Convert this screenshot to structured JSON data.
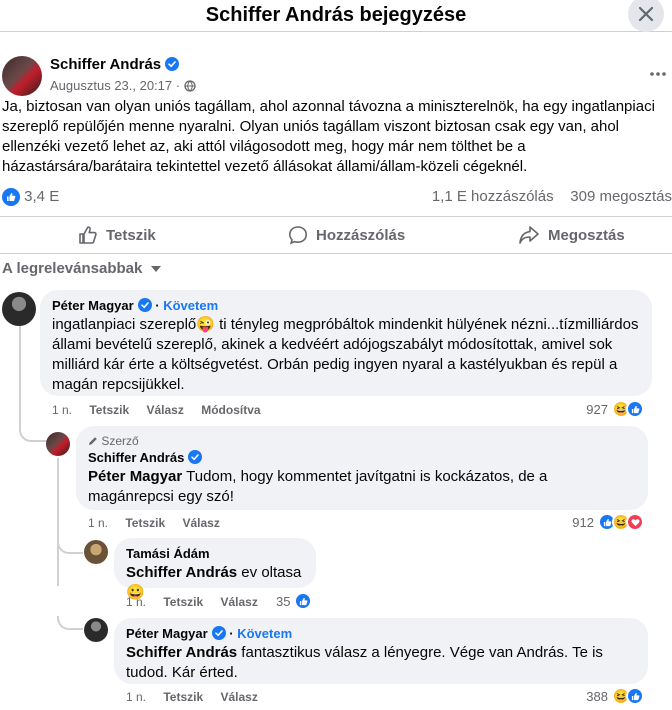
{
  "header": {
    "title": "Schiffer András bejegyzése"
  },
  "post": {
    "author": "Schiffer András",
    "date": "Augusztus 23., 20:17",
    "meta_sep": "·",
    "text": "Ja, biztosan van olyan uniós tagállam, ahol azonnal távozna a miniszterelnök, ha egy ingatlanpiaci szereplő repülőjén menne nyaralni. Olyan uniós tagállam viszont biztosan csak egy van, ahol ellenzéki vezető lehet az, aki attól világosodott meg, hogy már nem tölthet be a házastársára/barátaira tekintettel vezető állásokat állami/állam-közeli cégeknél.",
    "reactions": "3,4 E",
    "comments": "1,1 E hozzászólás",
    "shares": "309 megosztás"
  },
  "actions": {
    "like": "Tetszik",
    "comment": "Hozzászólás",
    "share": "Megosztás"
  },
  "sort": {
    "label": "A legrelevánsabbak"
  },
  "comments": [
    {
      "name": "Péter Magyar",
      "follow": "Követem",
      "text": "ingatlanpiaci szereplő😜 ti tényleg megpróbáltok mindenkit hülyének nézni...tízmilliárdos állami bevételű szereplő, akinek a kedvéért adójogszabályt módosítottak, amivel sok milliárd kár érte a költségvetést. Orbán pedig ingyen nyaral a kastélyukban és repül a magán repcsijükkel.",
      "time": "1 n.",
      "like": "Tetszik",
      "reply": "Válasz",
      "edited": "Módosítva",
      "count": "927"
    },
    {
      "badge": "Szerző",
      "name": "Schiffer András",
      "mention": "Péter Magyar",
      "text": " Tudom, hogy kommentet javítgatni is kockázatos, de a magánrepcsi egy szó!",
      "time": "1 n.",
      "like": "Tetszik",
      "reply": "Válasz",
      "count": "912"
    },
    {
      "name": "Tamási Ádám",
      "mention": "Schiffer András",
      "text": " ev oltasa 😀",
      "time": "1 n.",
      "like": "Tetszik",
      "reply": "Válasz",
      "count": "35"
    },
    {
      "name": "Péter Magyar",
      "follow": "Követem",
      "mention": "Schiffer András",
      "text": " fantasztikus válasz a lényegre. Vége van András. Te is tudod. Kár érted.",
      "time": "1 n.",
      "like": "Tetszik",
      "reply": "Válasz",
      "count": "388"
    }
  ],
  "colors": {
    "accent": "#1877f2",
    "muted": "#65676b",
    "bubble": "#f0f2f5"
  }
}
